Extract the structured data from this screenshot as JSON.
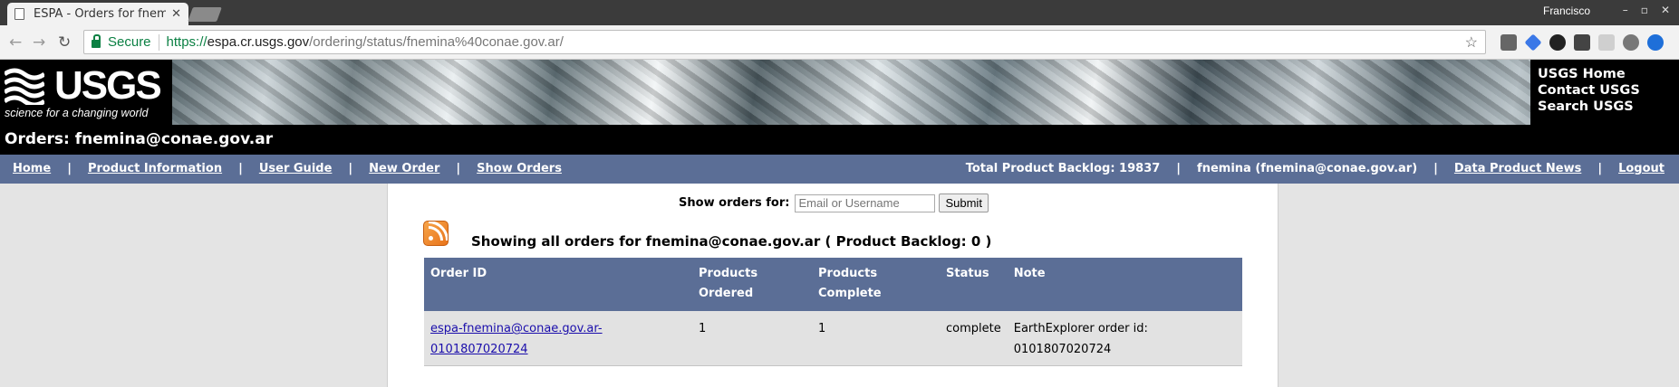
{
  "browser": {
    "tab_title": "ESPA - Orders for fnemina@conae.gov.ar",
    "user": "Francisco",
    "secure_label": "Secure",
    "url_scheme": "https://",
    "url_host": "espa.cr.usgs.gov",
    "url_path": "/ordering/status/fnemina%40conae.gov.ar/"
  },
  "banner": {
    "logo_word": "USGS",
    "tagline": "science for a changing world",
    "links": [
      "USGS Home",
      "Contact USGS",
      "Search USGS"
    ]
  },
  "page_title": "Orders: fnemina@conae.gov.ar",
  "nav": {
    "left": [
      "Home",
      "Product Information",
      "User Guide",
      "New Order",
      "Show Orders"
    ],
    "backlog": "Total Product Backlog: 19837",
    "user": "fnemina (fnemina@conae.gov.ar)",
    "news": "Data Product News",
    "logout": "Logout"
  },
  "filter": {
    "label": "Show orders for:",
    "placeholder": "Email or Username",
    "submit": "Submit"
  },
  "showing": "Showing all orders for fnemina@conae.gov.ar ( Product Backlog: 0 )",
  "table": {
    "headers": {
      "order_id": "Order ID",
      "products_ordered_1": "Products",
      "products_ordered_2": "Ordered",
      "products_complete_1": "Products",
      "products_complete_2": "Complete",
      "status": "Status",
      "note": "Note"
    },
    "rows": [
      {
        "order_id_1": "espa-fnemina@conae.gov.ar-",
        "order_id_2": "0101807020724",
        "ordered": "1",
        "complete": "1",
        "status": "complete",
        "note_1": "EarthExplorer order id:",
        "note_2": "0101807020724"
      }
    ]
  }
}
